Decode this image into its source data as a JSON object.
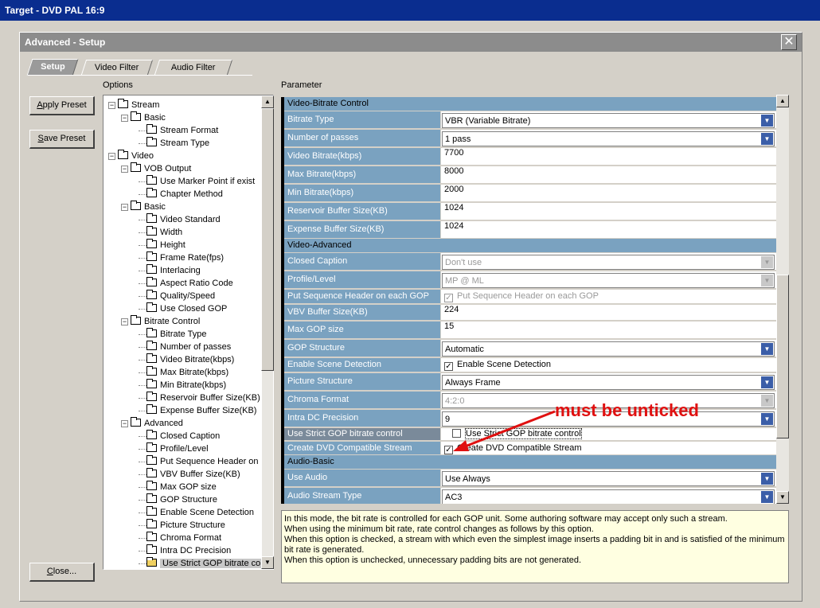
{
  "outer_title": "Target - DVD PAL 16:9",
  "window_title": "Advanced - Setup",
  "tabs": [
    "Setup",
    "Video Filter",
    "Audio Filter"
  ],
  "labels": {
    "options": "Options",
    "parameter": "Parameter"
  },
  "buttons": {
    "apply": "Apply Preset",
    "save": "Save Preset",
    "close": "Close..."
  },
  "tree": [
    {
      "t": "Stream",
      "d": 0
    },
    {
      "t": "Basic",
      "d": 1
    },
    {
      "t": "Stream Format",
      "d": 2
    },
    {
      "t": "Stream Type",
      "d": 2
    },
    {
      "t": "Video",
      "d": 0
    },
    {
      "t": "VOB Output",
      "d": 1
    },
    {
      "t": "Use Marker Point if exist",
      "d": 2
    },
    {
      "t": "Chapter Method",
      "d": 2
    },
    {
      "t": "Basic",
      "d": 1
    },
    {
      "t": "Video Standard",
      "d": 2
    },
    {
      "t": "Width",
      "d": 2
    },
    {
      "t": "Height",
      "d": 2
    },
    {
      "t": "Frame Rate(fps)",
      "d": 2
    },
    {
      "t": "Interlacing",
      "d": 2
    },
    {
      "t": "Aspect Ratio Code",
      "d": 2
    },
    {
      "t": "Quality/Speed",
      "d": 2
    },
    {
      "t": "Use Closed GOP",
      "d": 2
    },
    {
      "t": "Bitrate Control",
      "d": 1
    },
    {
      "t": "Bitrate Type",
      "d": 2
    },
    {
      "t": "Number of passes",
      "d": 2
    },
    {
      "t": "Video Bitrate(kbps)",
      "d": 2
    },
    {
      "t": "Max Bitrate(kbps)",
      "d": 2
    },
    {
      "t": "Min Bitrate(kbps)",
      "d": 2
    },
    {
      "t": "Reservoir Buffer Size(KB)",
      "d": 2
    },
    {
      "t": "Expense Buffer Size(KB)",
      "d": 2
    },
    {
      "t": "Advanced",
      "d": 1
    },
    {
      "t": "Closed Caption",
      "d": 2
    },
    {
      "t": "Profile/Level",
      "d": 2
    },
    {
      "t": "Put Sequence Header on",
      "d": 2
    },
    {
      "t": "VBV Buffer Size(KB)",
      "d": 2
    },
    {
      "t": "Max GOP size",
      "d": 2
    },
    {
      "t": "GOP Structure",
      "d": 2
    },
    {
      "t": "Enable Scene Detection",
      "d": 2
    },
    {
      "t": "Picture Structure",
      "d": 2
    },
    {
      "t": "Chroma Format",
      "d": 2
    },
    {
      "t": "Intra DC Precision",
      "d": 2
    },
    {
      "t": "Use Strict GOP bitrate cor",
      "d": 2,
      "sel": true
    }
  ],
  "sections": {
    "vbc": "Video-Bitrate Control",
    "va": "Video-Advanced",
    "ab": "Audio-Basic"
  },
  "params": {
    "bitrate_type": {
      "label": "Bitrate Type",
      "value": "VBR (Variable Bitrate)"
    },
    "passes": {
      "label": "Number of passes",
      "value": "1 pass"
    },
    "video_bitrate": {
      "label": "Video Bitrate(kbps)",
      "value": "7700"
    },
    "max_bitrate": {
      "label": "Max Bitrate(kbps)",
      "value": "8000"
    },
    "min_bitrate": {
      "label": "Min Bitrate(kbps)",
      "value": "2000"
    },
    "reservoir": {
      "label": "Reservoir Buffer Size(KB)",
      "value": "1024"
    },
    "expense": {
      "label": "Expense Buffer Size(KB)",
      "value": "1024"
    },
    "closed_caption": {
      "label": "Closed Caption",
      "value": "Don't use"
    },
    "profile": {
      "label": "Profile/Level",
      "value": "MP @ ML"
    },
    "seq_header": {
      "label": "Put Sequence Header on each GOP",
      "value": "Put Sequence Header on each GOP",
      "checked": true
    },
    "vbv": {
      "label": "VBV Buffer Size(KB)",
      "value": "224"
    },
    "max_gop": {
      "label": "Max GOP size",
      "value": "15"
    },
    "gop_structure": {
      "label": "GOP Structure",
      "value": "Automatic"
    },
    "scene_detect": {
      "label": "Enable Scene Detection",
      "value": "Enable Scene Detection",
      "checked": true
    },
    "picture_structure": {
      "label": "Picture Structure",
      "value": "Always Frame"
    },
    "chroma": {
      "label": "Chroma Format",
      "value": "4:2:0"
    },
    "intra_dc": {
      "label": "Intra DC Precision",
      "value": "9"
    },
    "strict_gop": {
      "label": "Use Strict GOP bitrate control",
      "value": "Use Strict GOP bitrate control",
      "checked": false
    },
    "dvd_compat": {
      "label": "Create DVD Compatible Stream",
      "value": "Create DVD Compatible Stream",
      "checked": true
    },
    "use_audio": {
      "label": "Use Audio",
      "value": "Use Always"
    },
    "audio_type": {
      "label": "Audio Stream Type",
      "value": "AC3"
    }
  },
  "description": [
    "In this mode, the bit rate is controlled for each GOP unit. Some authoring software may accept only such a stream.",
    "When using the minimum bit rate, rate control changes as follows by this option.",
    "When this option is checked, a stream with which even the simplest image inserts a padding bit in and is satisfied of the minimum bit rate is generated.",
    "When this option is unchecked, unnecessary padding bits are not generated."
  ],
  "annotation": "must be unticked",
  "colors": {
    "annotation": "#e01010",
    "section": "#7aa2c0",
    "description_bg": "#ffffe1"
  }
}
